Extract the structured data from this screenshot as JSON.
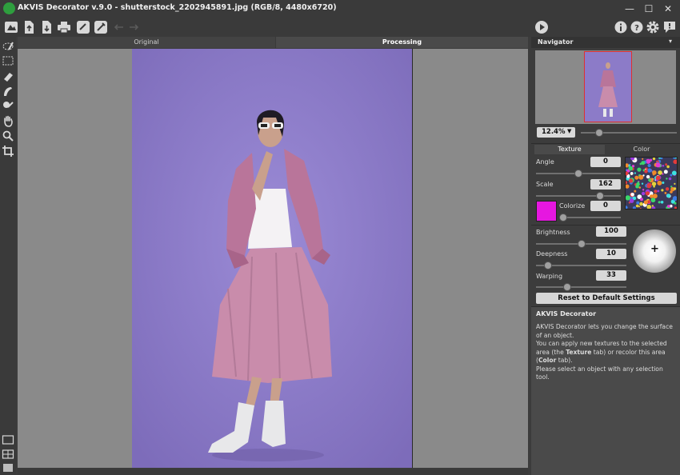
{
  "window": {
    "title": "AKVIS Decorator v.9.0 - shutterstock_2202945891.jpg (RGB/8, 4480x6720)",
    "controls": {
      "minimize": "—",
      "maximize": "☐",
      "close": "✕"
    }
  },
  "toolbar": {
    "icons": [
      "home-icon",
      "open-file-icon",
      "save-file-icon",
      "print-icon",
      "share-icon",
      "preferences-icon",
      "undo-icon",
      "redo-icon",
      "run-icon",
      "info-icon",
      "help-icon",
      "settings-icon",
      "notification-icon"
    ]
  },
  "tools": {
    "items": [
      "selection-brush-icon",
      "rectangle-selection-icon",
      "eraser-icon",
      "lasso-icon",
      "magic-brush-icon",
      "hand-icon",
      "zoom-icon",
      "crop-icon"
    ],
    "bottom": [
      "view-one-icon",
      "view-two-icon",
      "view-three-icon"
    ]
  },
  "view": {
    "tab_original": "Original",
    "tab_processing": "Processing"
  },
  "navigator": {
    "title": "Navigator",
    "zoom": "12.4%",
    "zoom_level": 0.16
  },
  "settings": {
    "tab_texture": "Texture",
    "tab_color": "Color",
    "angle": {
      "label": "Angle",
      "value": "0",
      "level": 0.5
    },
    "scale": {
      "label": "Scale",
      "value": "162",
      "level": 0.78
    },
    "colorize": {
      "label": "Colorize",
      "value": "0",
      "level": 0.0,
      "swatch": "#e617e0"
    },
    "brightness": {
      "label": "Brightness",
      "value": "100",
      "level": 0.5
    },
    "deepness": {
      "label": "Deepness",
      "value": "10",
      "level": 0.1
    },
    "warping": {
      "label": "Warping",
      "value": "33",
      "level": 0.33
    },
    "reset_label": "Reset to Default Settings"
  },
  "help": {
    "title": "AKVIS Decorator",
    "line1": "AKVIS Decorator lets you change the surface of an object.",
    "line2a": "You can apply new textures to the selected area (the ",
    "line2b": "Texture",
    "line2c": " tab) or recolor this area (",
    "line2d": "Color",
    "line2e": " tab).",
    "line3": "Please select an object with any selection tool."
  },
  "colors": {
    "accent": "#e617e0",
    "panel": "#3c3c3c",
    "photo_bg": "#8c7bc8"
  }
}
